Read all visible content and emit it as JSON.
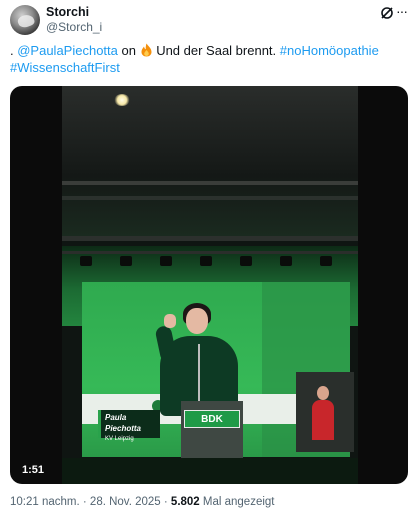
{
  "author": {
    "display_name": "Storchi",
    "handle": "@Storch_i"
  },
  "header_icons": [
    "grok-icon",
    "more-icon"
  ],
  "tweet": {
    "prefix": ". ",
    "mention": "@PaulaPiechotta",
    "on": " on ",
    "fire_emoji": "fire-icon",
    "body": " Und der Saal brennt. ",
    "hashtag1": "#noHomöopathie",
    "hashtag2": "#WissenschaftFirst"
  },
  "video": {
    "duration": "1:51",
    "lectern_sign": "BDK",
    "name_plate": {
      "name": "Paula Piechotta",
      "subtitle": "KV Leipzig"
    }
  },
  "meta": {
    "time": "10:21 nachm.",
    "separator": " · ",
    "date": "28. Nov. 2025",
    "views_count": "5.802",
    "views_label": " Mal angezeigt"
  },
  "colors": {
    "link": "#1d9bf0",
    "text": "#0f1419",
    "muted": "#536471",
    "stage_green": "#2faa4f"
  }
}
